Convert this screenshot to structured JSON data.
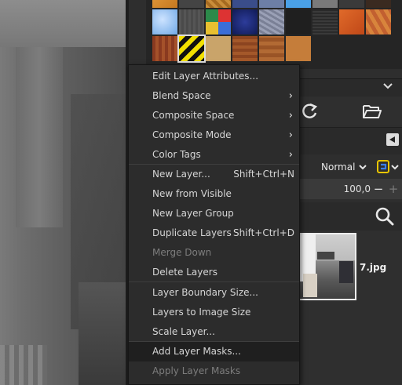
{
  "menu": {
    "items": [
      {
        "label": "Edit Layer Attributes...",
        "shortcut": "",
        "submenu": false,
        "enabled": true
      },
      {
        "label": "Blend Space",
        "shortcut": "",
        "submenu": true,
        "enabled": true
      },
      {
        "label": "Composite Space",
        "shortcut": "",
        "submenu": true,
        "enabled": true
      },
      {
        "label": "Composite Mode",
        "shortcut": "",
        "submenu": true,
        "enabled": true
      },
      {
        "label": "Color Tags",
        "shortcut": "",
        "submenu": true,
        "enabled": true
      },
      {
        "label": "New Layer...",
        "shortcut": "Shift+Ctrl+N",
        "submenu": false,
        "enabled": true
      },
      {
        "label": "New from Visible",
        "shortcut": "",
        "submenu": false,
        "enabled": true
      },
      {
        "label": "New Layer Group",
        "shortcut": "",
        "submenu": false,
        "enabled": true
      },
      {
        "label": "Duplicate Layers",
        "shortcut": "Shift+Ctrl+D",
        "submenu": false,
        "enabled": true
      },
      {
        "label": "Merge Down",
        "shortcut": "",
        "submenu": false,
        "enabled": false
      },
      {
        "label": "Delete Layers",
        "shortcut": "",
        "submenu": false,
        "enabled": true
      },
      {
        "label": "Layer Boundary Size...",
        "shortcut": "",
        "submenu": false,
        "enabled": true
      },
      {
        "label": "Layers to Image Size",
        "shortcut": "",
        "submenu": false,
        "enabled": true
      },
      {
        "label": "Scale Layer...",
        "shortcut": "",
        "submenu": false,
        "enabled": true
      },
      {
        "label": "Add Layer Masks...",
        "shortcut": "",
        "submenu": false,
        "enabled": true,
        "hovered": true
      },
      {
        "label": "Apply Layer Masks",
        "shortcut": "",
        "submenu": false,
        "enabled": false
      }
    ]
  },
  "layers_panel": {
    "mode": "Normal",
    "opacity": "100,0",
    "layer_name": "7.jpg"
  },
  "icons": {
    "submenu_arrow": "›",
    "chevron_down": "⌄",
    "minus": "−",
    "plus": "+"
  },
  "colors": {
    "menu_bg": "#2c2c2c",
    "hover_bg": "#1f1f1f",
    "disabled_text": "#7d7d7d"
  }
}
